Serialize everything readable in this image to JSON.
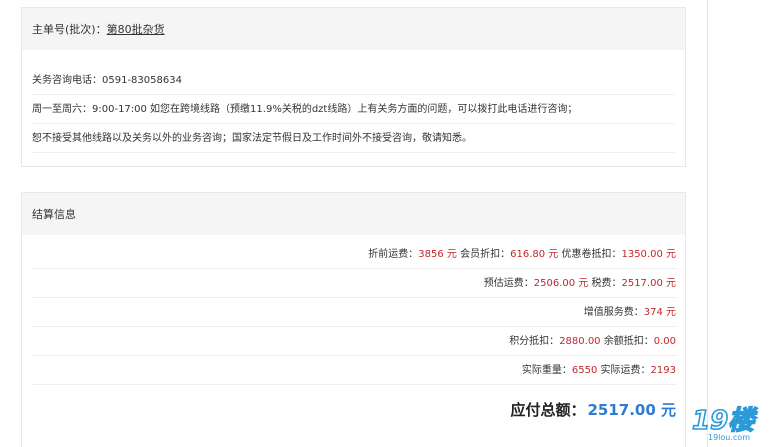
{
  "order": {
    "label": "主单号(批次)：",
    "batch_link": "第80批杂货"
  },
  "customs": {
    "phone": "关务咨询电话：0591-83058634",
    "hours": "周一至周六：9:00-17:00 如您在跨境线路（预缴11.9%关税的dzt线路）上有关务方面的问题，可以拨打此电话进行咨询；",
    "notice": "恕不接受其他线路以及关务以外的业务咨询；国家法定节假日及工作时间外不接受咨询，敬请知悉。"
  },
  "settlement": {
    "title": "结算信息",
    "row1": {
      "pre_freight_label": "折前运费：",
      "pre_freight_value": "3856 元",
      "member_discount_label": " 会员折扣：",
      "member_discount_value": "616.80 元",
      "coupon_label": " 优惠卷抵扣：",
      "coupon_value": "1350.00 元"
    },
    "row2": {
      "est_freight_label": "预估运费：",
      "est_freight_value": "2506.00 元",
      "tax_label": " 税费：",
      "tax_value": "2517.00 元"
    },
    "row3": {
      "service_label": "增值服务费：",
      "service_value": "374 元"
    },
    "row4": {
      "points_label": "积分抵扣：",
      "points_value": "2880.00",
      "balance_label": " 余额抵扣：",
      "balance_value": "0.00"
    },
    "row5": {
      "weight_label": "实际重量：",
      "weight_value": "6550",
      "actual_freight_label": " 实际运费：",
      "actual_freight_value": "2193"
    },
    "total_label": "应付总额：",
    "total_value": "2517.00 元"
  },
  "watermark": {
    "text": "19楼",
    "sub": "19lou.com",
    "color": "#2d9ad8"
  }
}
